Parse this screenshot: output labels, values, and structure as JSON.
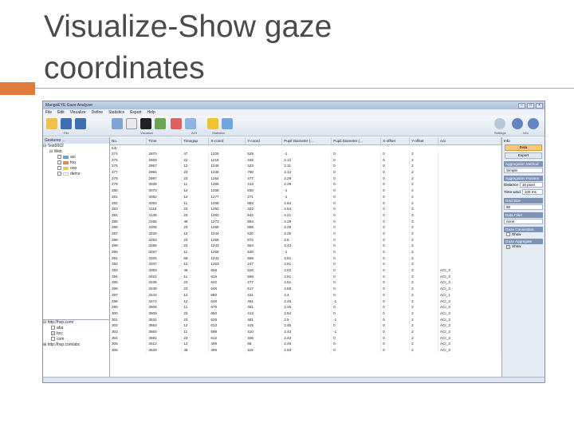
{
  "slide": {
    "title_line1": "Visualize-Show gaze",
    "title_line2": "coordinates",
    "accent_color": "#e07b3a"
  },
  "app": {
    "window_title": "MangoEYE Gaze Analyzer",
    "menu": [
      "File",
      "Edit",
      "Visualize",
      "Define",
      "Statistics",
      "Export",
      "Help"
    ],
    "toolbar_groups": [
      "File",
      "Visualize",
      "AOI",
      "Statistics",
      "Settings",
      "Info"
    ]
  },
  "left_panel": {
    "header": "Gestures ...",
    "tree_root": "Test0002",
    "tree_web": "Web",
    "tree_items": [
      {
        "label": "aoi",
        "color": "#6a9fd8",
        "checked": false
      },
      {
        "label": "foo",
        "color": "#e08a4a",
        "checked": false
      },
      {
        "label": "ooo",
        "color": "#f2c84b",
        "checked": false
      },
      {
        "label": "demo",
        "color": "#ffffff",
        "checked": false
      }
    ],
    "bottom_url1": "http://hsp.com/",
    "bottom_items": [
      {
        "label": "aba",
        "checked": false
      },
      {
        "label": "bcc",
        "checked": true
      },
      {
        "label": "com",
        "checked": false
      }
    ],
    "bottom_url2": "http://hsp.com/abc"
  },
  "table": {
    "columns": [
      "No.",
      "Time",
      "Timegap",
      "X-coord",
      "Y-coord",
      "Pupil Diameter (...",
      "Pupil Diameter (...",
      "X-offset",
      "Y-offset",
      "Aoi"
    ],
    "group_label": "tob",
    "rows": [
      [
        "274",
        "2870",
        "47",
        "1225",
        "529",
        "-1",
        "0",
        "0",
        "2",
        ""
      ],
      [
        "275",
        "2929",
        "22",
        "1218",
        "348",
        "2.12",
        "0",
        "0",
        "2",
        ""
      ],
      [
        "276",
        "2957",
        "12",
        "1246",
        "423",
        "2.11",
        "0",
        "0",
        "2",
        ""
      ],
      [
        "277",
        "2994",
        "23",
        "1238",
        "750",
        "2.12",
        "0",
        "0",
        "2",
        ""
      ],
      [
        "278",
        "2997",
        "23",
        "1254",
        "477",
        "2.29",
        "0",
        "0",
        "2",
        ""
      ],
      [
        "279",
        "3038",
        "11",
        "1266",
        "413",
        "2.29",
        "0",
        "0",
        "2",
        ""
      ],
      [
        "280",
        "3070",
        "12",
        "1265",
        "830",
        "-1",
        "0",
        "0",
        "2",
        ""
      ],
      [
        "281",
        "3082",
        "12",
        "1277",
        "271",
        "-1",
        "0",
        "0",
        "2",
        ""
      ],
      [
        "282",
        "3093",
        "11",
        "1265",
        "883",
        "2.64",
        "0",
        "0",
        "2",
        ""
      ],
      [
        "283",
        "3116",
        "23",
        "1282",
        "322",
        "2.54",
        "0",
        "0",
        "2",
        ""
      ],
      [
        "284",
        "3139",
        "23",
        "1262",
        "542",
        "2.21",
        "0",
        "0",
        "2",
        ""
      ],
      [
        "285",
        "3155",
        "46",
        "1273",
        "554",
        "2.29",
        "0",
        "0",
        "2",
        ""
      ],
      [
        "286",
        "3208",
        "23",
        "1269",
        "866",
        "2.29",
        "0",
        "0",
        "2",
        ""
      ],
      [
        "287",
        "3230",
        "12",
        "1244",
        "520",
        "2.25",
        "0",
        "0",
        "2",
        ""
      ],
      [
        "288",
        "3253",
        "23",
        "1258",
        "872",
        "2.5",
        "0",
        "0",
        "2",
        ""
      ],
      [
        "289",
        "3286",
        "23",
        "1243",
        "554",
        "2.43",
        "0",
        "0",
        "2",
        ""
      ],
      [
        "290",
        "3297",
        "11",
        "1258",
        "530",
        "-1",
        "0",
        "0",
        "2",
        ""
      ],
      [
        "291",
        "3325",
        "58",
        "1242",
        "558",
        "2.51",
        "0",
        "0",
        "2",
        ""
      ],
      [
        "292",
        "3347",
        "12",
        "1253",
        "247",
        "2.51",
        "0",
        "0",
        "2",
        ""
      ],
      [
        "293",
        "3353",
        "46",
        "606",
        "526",
        "2.52",
        "0",
        "0",
        "2",
        "ACI_3"
      ],
      [
        "294",
        "3424",
        "11",
        "618",
        "569",
        "2.51",
        "0",
        "0",
        "2",
        "ACI_3"
      ],
      [
        "295",
        "3436",
        "23",
        "642",
        "477",
        "2.51",
        "0",
        "0",
        "2",
        "ACI_3"
      ],
      [
        "296",
        "3439",
        "23",
        "648",
        "517",
        "2.58",
        "0",
        "0",
        "2",
        "ACI_3"
      ],
      [
        "297",
        "3442",
        "12",
        "680",
        "431",
        "2.4",
        "0",
        "0",
        "2",
        "ACI_1"
      ],
      [
        "298",
        "3474",
        "12",
        "648",
        "481",
        "2.45",
        "-1",
        "0",
        "2",
        "ACI_3"
      ],
      [
        "299",
        "3506",
        "11",
        "676",
        "481",
        "2.26",
        "0",
        "0",
        "2",
        "ACI_3"
      ],
      [
        "300",
        "3509",
        "23",
        "650",
        "413",
        "2.54",
        "0",
        "0",
        "2",
        "ACI_3"
      ],
      [
        "301",
        "3531",
        "23",
        "628",
        "481",
        "2.5",
        "-1",
        "0",
        "2",
        "ACI_3"
      ],
      [
        "302",
        "3553",
        "12",
        "613",
        "415",
        "2.45",
        "0",
        "0",
        "2",
        "ACI_3"
      ],
      [
        "303",
        "3564",
        "11",
        "599",
        "410",
        "2.43",
        "-1",
        "0",
        "2",
        "ACI_3"
      ],
      [
        "304",
        "3591",
        "23",
        "612",
        "406",
        "2.43",
        "0",
        "0",
        "2",
        "ACI_3"
      ],
      [
        "305",
        "3612",
        "12",
        "409",
        "58",
        "2.49",
        "0",
        "0",
        "2",
        "ACI_3"
      ],
      [
        "306",
        "3639",
        "46",
        "406",
        "116",
        "2.53",
        "0",
        "0",
        "2",
        "ACI_3"
      ]
    ]
  },
  "right_panel": {
    "info_label": "Info",
    "data_button": "Data",
    "export_button": "Export",
    "aggregation_method_label": "Aggregation Method",
    "aggregation_method_value": "Simple",
    "aggregation_params_label": "Aggregation Params",
    "distance_label": "Distance",
    "distance_value": "10 pixel",
    "time_label": "Time wind",
    "time_value": "100 ms",
    "grid_size_label": "Grid Size",
    "grid_size_value": "80",
    "data_filter_label": "Data Filter",
    "data_filter_value": "none",
    "gaze_connection_label": "Gaze Connection",
    "gaze_connection_value": "Show",
    "gaze_aggregate_label": "Gaze Aggregate",
    "gaze_aggregate_value": "Show"
  }
}
